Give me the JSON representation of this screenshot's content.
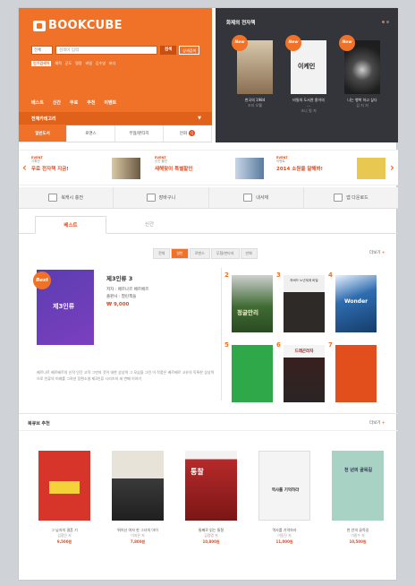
{
  "logo": {
    "text": "BOOKCUBE",
    "sub": "북큐브"
  },
  "search": {
    "scope": "전체",
    "placeholder": "검색어 입력",
    "button": "검색",
    "detail": "상세검색"
  },
  "popular": {
    "label": "인기검색어",
    "items": [
      "해적",
      "군도",
      "명량",
      "비밀",
      "김수영",
      "바다"
    ]
  },
  "gnb": [
    "베스트",
    "신간",
    "무료",
    "추천",
    "이벤트"
  ],
  "category": {
    "label": "전체카테고리"
  },
  "category_tabs": [
    "일반도서",
    "로맨스",
    "무협/판타지",
    "만화"
  ],
  "dark_panel": {
    "title": "화제의 전자책",
    "books": [
      {
        "badge": "New",
        "title": "천국의 1984",
        "author": "조지 오웰",
        "color": "#a98f6e"
      },
      {
        "badge": "New",
        "title": "비밀의 도서관 종이의 ...",
        "author": "조니 필 저",
        "color": "#f2f2f2"
      },
      {
        "badge": "New",
        "title": "나는 행복 하고 싶다",
        "author": "김 지 저",
        "color": "#2b2b2b"
      }
    ]
  },
  "events": [
    {
      "label": "EVENT",
      "sub": "기획전",
      "text": "무료 전자책 지금!",
      "color": "#7b6b58"
    },
    {
      "label": "EVENT",
      "sub": "신간 할인",
      "text": "새해맞이 특별할인",
      "color": "#5a7b9e"
    },
    {
      "label": "EVENT",
      "sub": "이벤트",
      "text": "2014 소원을 말해봐!",
      "color": "#d9b23a"
    }
  ],
  "quick": [
    "북캐시 충전",
    "장바구니",
    "내서재",
    "앱 다운로드"
  ],
  "best_tabs": [
    "베스트",
    "신간"
  ],
  "filters": [
    "전체",
    "일반",
    "로맨스",
    "무협/판타지",
    "만화"
  ],
  "more": "더보기",
  "best_book": {
    "badge": "Best",
    "cover_title": "제3인류",
    "title": "제3인류 3",
    "author": "저자 : 베르나르 베르베르",
    "publisher": "출판사 : 열린책들",
    "price": "₩ 9,000",
    "description": "베르나르 베르베르의 신작 인간 고작 그만의 것이 대한 상상력 그 모습을 그린 이 작품은 베르베르 고유의 독특한 상상력으로 인류의 미래를 그려낸 장편소설 제3인류 시리즈의 세 번째 이야기"
  },
  "ranks": [
    {
      "n": "2",
      "title": "정글만리",
      "color": "#3f6b33"
    },
    {
      "n": "3",
      "title": "하버드 노년세계 비밀",
      "color": "#2d2a28"
    },
    {
      "n": "4",
      "title": "Wonder",
      "color": "#2f6db0"
    },
    {
      "n": "5",
      "title": "",
      "color": "#2fa84a"
    },
    {
      "n": "6",
      "title": "드래곤라자",
      "color": "#2a2525"
    },
    {
      "n": "7",
      "title": "",
      "color": "#e24f1c"
    }
  ],
  "recommend": {
    "title": "북큐브 추천",
    "books": [
      {
        "title": "그 남자의 결혼 기",
        "author": "김정민 저",
        "price": "9,500원",
        "color": "#d7352a"
      },
      {
        "title": "뛰어난 여자 한 그녀의 아이",
        "author": "이지은 저",
        "price": "7,800원",
        "color": "#e8e3d8"
      },
      {
        "title": "통째로 읽는 통찰",
        "author": "김정명 저",
        "price": "10,800원",
        "color": "#b72a2a"
      },
      {
        "title": "역사를 기억하라",
        "author": "이동진 저",
        "price": "11,000원",
        "color": "#f4f4f4"
      },
      {
        "title": "천 년의 골목길",
        "author": "이종수 저",
        "price": "10,500원",
        "color": "#a8d3c4"
      }
    ]
  }
}
